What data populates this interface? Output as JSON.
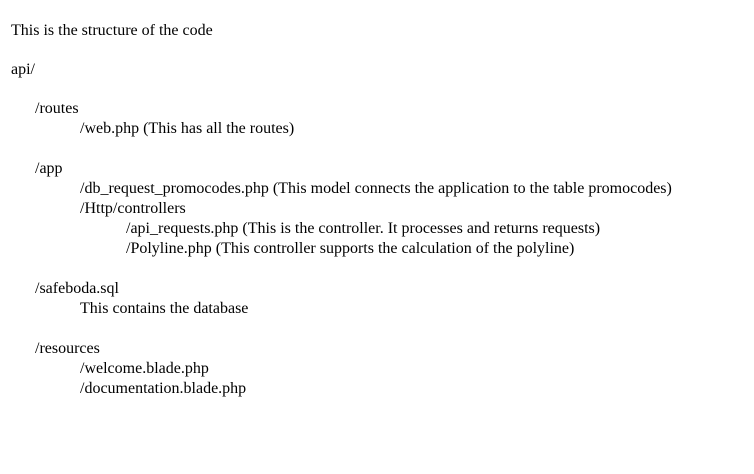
{
  "intro": "This is the structure of the code",
  "root": "api/",
  "routes": {
    "dir": "/routes",
    "web": "/web.php (This has all the routes)"
  },
  "app": {
    "dir": "/app",
    "model": "/db_request_promocodes.php (This model connects the application to the table promocodes)",
    "controllers_dir": "/Http/controllers",
    "api_requests": "/api_requests.php (This is the controller. It processes and returns requests)",
    "polyline": "/Polyline.php (This controller supports the calculation of the polyline)"
  },
  "sql": {
    "file": "/safeboda.sql",
    "desc": "This contains the database"
  },
  "resources": {
    "dir": "/resources",
    "welcome": "/welcome.blade.php",
    "documentation": "/documentation.blade.php"
  }
}
